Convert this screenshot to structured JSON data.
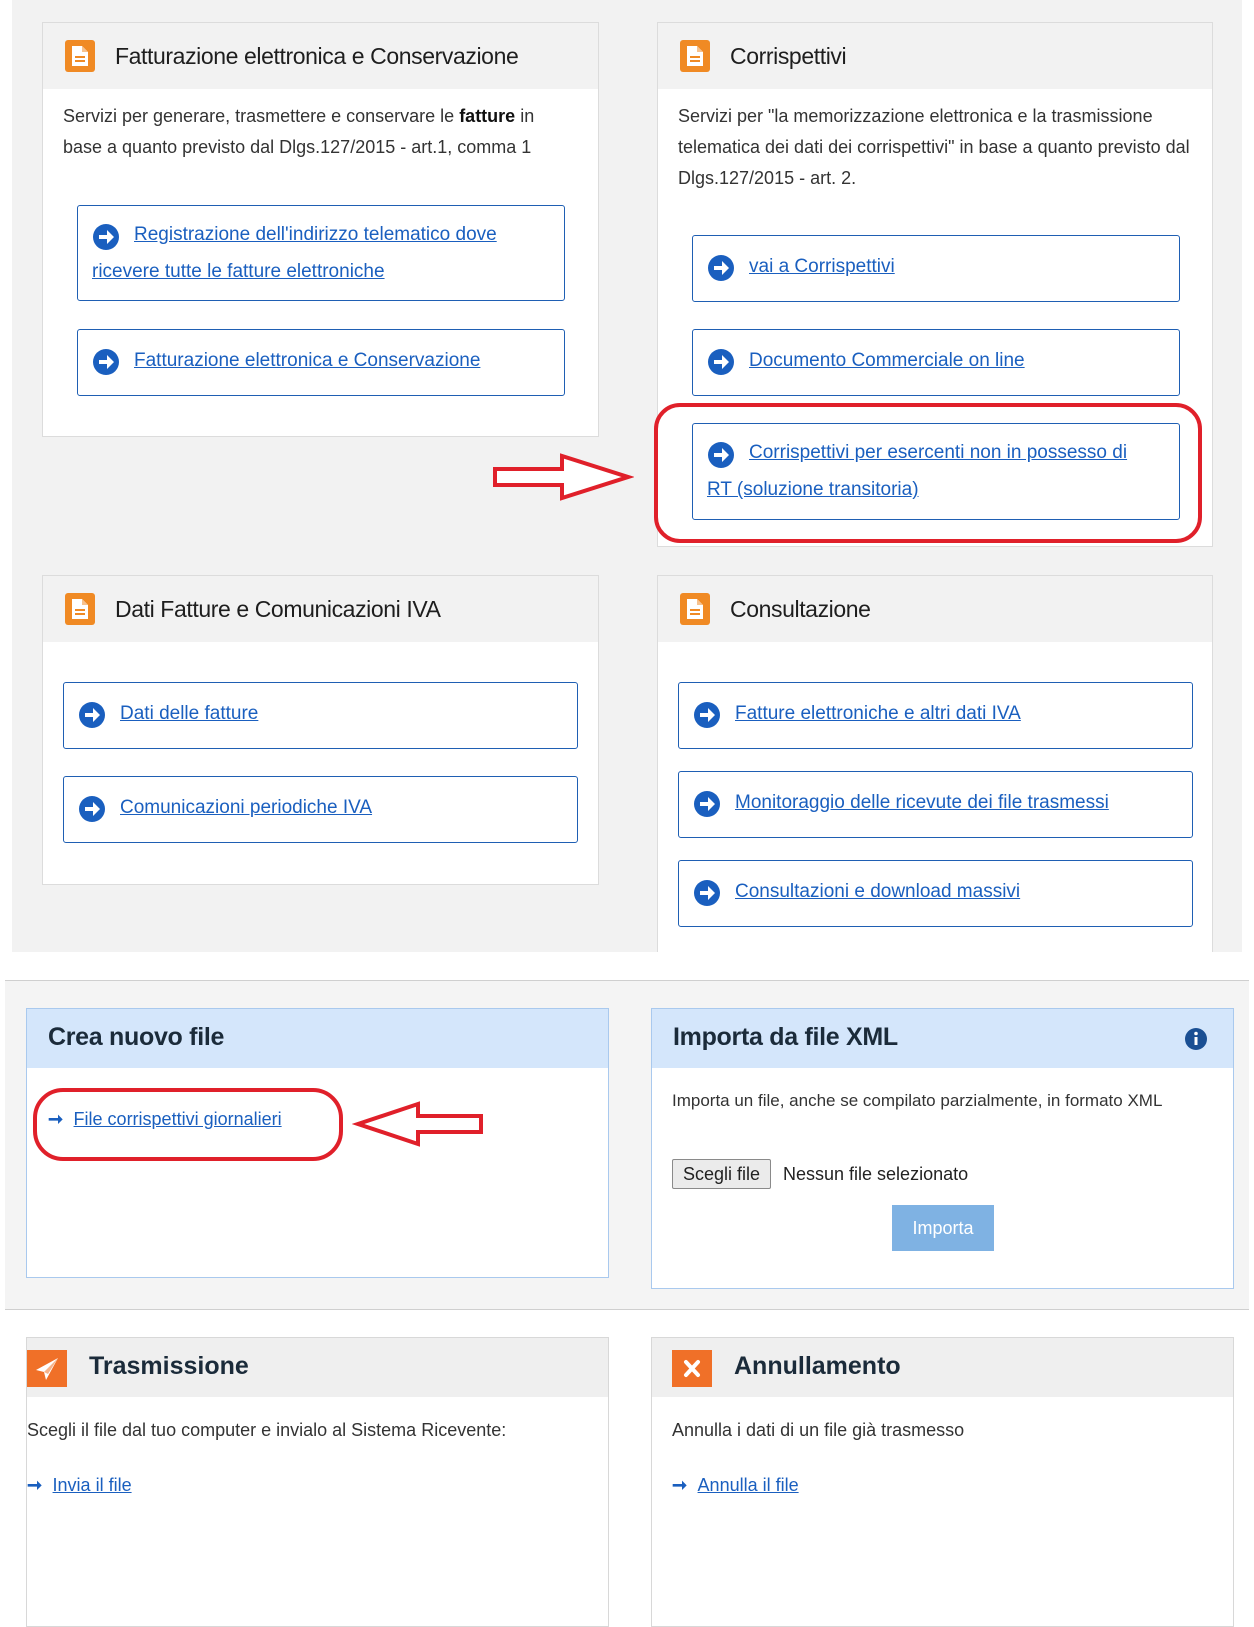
{
  "colors": {
    "accent_orange": "#f08a24",
    "link_blue": "#1a5fbf",
    "highlight_red": "#e0202a",
    "light_blue_header": "#d4e6fb"
  },
  "fatturazione": {
    "icon": "document-icon",
    "title": "Fatturazione elettronica e Conservazione",
    "desc_pre": "Servizi per generare, trasmettere e conservare le ",
    "desc_bold": "fatture",
    "desc_post": " in base a quanto previsto dal Dlgs.127/2015 - art.1, comma 1",
    "links": [
      {
        "label_line1": "Registrazione dell'indirizzo telematico dove",
        "label_line2": "ricevere tutte le fatture elettroniche"
      },
      {
        "label": "Fatturazione elettronica e Conservazione"
      }
    ]
  },
  "corrispettivi": {
    "icon": "document-icon",
    "title": "Corrispettivi",
    "desc": "Servizi per \"la memorizzazione elettronica e la trasmissione telematica dei dati dei corrispettivi\" in base a quanto previsto dal Dlgs.127/2015 - art. 2.",
    "links": [
      {
        "label": "vai a Corrispettivi"
      },
      {
        "label": "Documento Commerciale on line"
      },
      {
        "label_line1": "Corrispettivi per esercenti non in possesso di",
        "label_line2": "RT (soluzione transitoria)"
      }
    ]
  },
  "dati_fatture": {
    "icon": "document-icon",
    "title": "Dati Fatture e Comunicazioni IVA",
    "links": [
      {
        "label": "Dati delle fatture"
      },
      {
        "label": "Comunicazioni periodiche IVA"
      }
    ]
  },
  "consultazione": {
    "icon": "document-icon",
    "title": "Consultazione",
    "links": [
      {
        "label": "Fatture elettroniche e altri dati IVA"
      },
      {
        "label": "Monitoraggio delle ricevute dei file trasmessi"
      },
      {
        "label": "Consultazioni e download massivi"
      }
    ]
  },
  "crea_nuovo": {
    "title": "Crea nuovo file",
    "link": "File corrispettivi giornalieri"
  },
  "importa": {
    "title": "Importa da file XML",
    "info_icon": "info-icon",
    "desc": "Importa un file, anche se compilato parzialmente, in formato XML",
    "choose_label": "Scegli file",
    "no_file": "Nessun file selezionato",
    "import_label": "Importa"
  },
  "trasmissione": {
    "icon": "paper-plane-icon",
    "title": "Trasmissione",
    "desc": "Scegli il file dal tuo computer e invialo al Sistema Ricevente:",
    "link": "Invia il file"
  },
  "annullamento": {
    "icon": "close-icon",
    "title": "Annullamento",
    "desc": "Annulla i dati di un file già trasmesso",
    "link": "Annulla il file"
  }
}
